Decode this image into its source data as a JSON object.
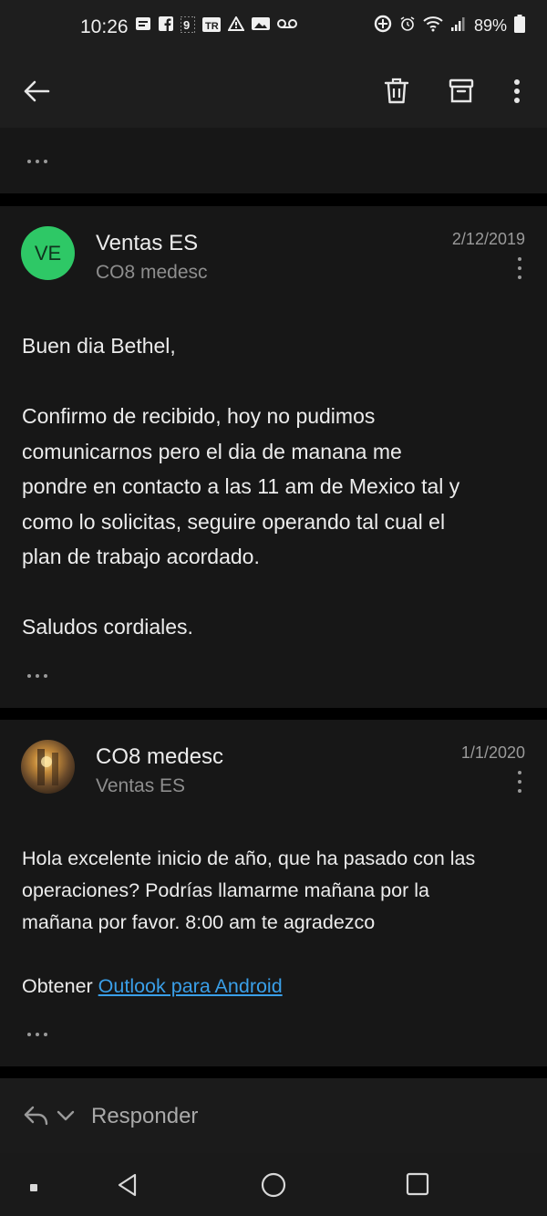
{
  "status_bar": {
    "time": "10:26",
    "battery": "89%",
    "notification_icons": [
      "message-icon",
      "facebook-icon",
      "nine-gag-icon",
      "app-tr-icon",
      "alert-triangle-icon",
      "image-icon",
      "voicemail-icon"
    ],
    "system_icons": [
      "data-saver-icon",
      "alarm-icon",
      "wifi-icon",
      "signal-icon",
      "battery-icon"
    ]
  },
  "app_bar": {
    "icons": [
      "back-arrow-icon",
      "trash-icon",
      "archive-icon",
      "more-vert-icon"
    ]
  },
  "messages": [
    {
      "avatar_initials": "VE",
      "avatar_color": "#2ec866",
      "sender": "Ventas ES",
      "recipient": "CO8 medesc",
      "date": "2/12/2019",
      "greeting": "Buen dia Bethel,",
      "lines": [
        "Confirmo de recibido, hoy no pudimos",
        "comunicarnos pero el dia de manana me",
        "pondre en contacto a las 11 am de Mexico tal y",
        "como lo solicitas, seguire operando tal cual el",
        "plan de trabajo acordado."
      ],
      "closing": "Saludos cordiales."
    },
    {
      "sender": "CO8 medesc",
      "recipient": "Ventas ES",
      "date": "1/1/2020",
      "lines": [
        "Hola excelente inicio de año, que ha pasado con las",
        "operaciones? Podrías llamarme mañana por la",
        "mañana por favor. 8:00 am te agradezco"
      ],
      "signature_prefix": "Obtener",
      "signature_link": "Outlook para Android"
    }
  ],
  "reply_bar": {
    "label": "Responder"
  },
  "colors": {
    "background": "#000000",
    "card": "#171717",
    "bar": "#1e1e1e",
    "accent_green": "#2ec866",
    "link": "#3a9fe8"
  }
}
